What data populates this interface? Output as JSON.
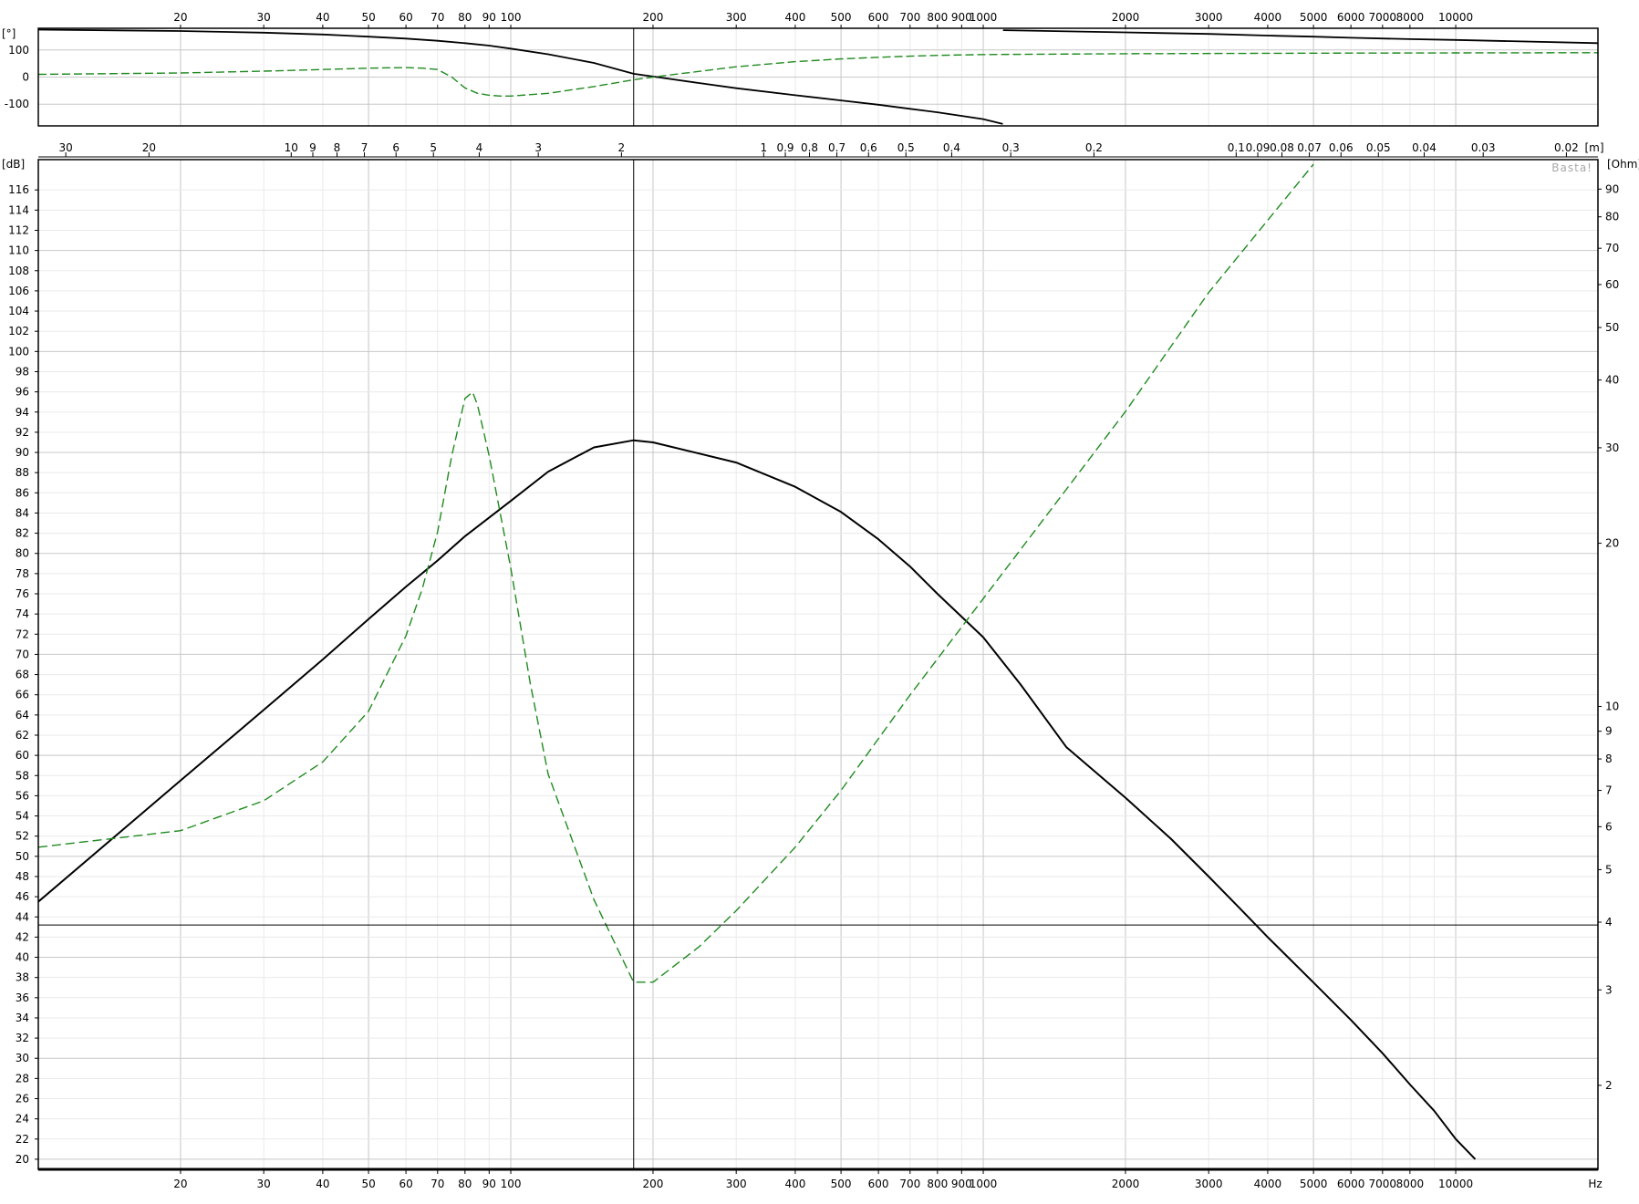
{
  "chart_data": [
    {
      "type": "line",
      "panel": "phase",
      "ylabel": "[°]",
      "y_ticks": [
        -100,
        0,
        100
      ],
      "x_ticks": [
        20,
        30,
        40,
        50,
        60,
        70,
        80,
        90,
        100,
        200,
        300,
        400,
        500,
        600,
        700,
        800,
        900,
        1000,
        2000,
        3000,
        4000,
        5000,
        6000,
        7000,
        8000,
        10000
      ],
      "xlim": [
        10,
        20000
      ],
      "ylim": [
        -180,
        180
      ],
      "x_scale": "log",
      "grid": true,
      "cursor_x": 182,
      "series": [
        {
          "color": "#000000",
          "style": "solid",
          "x": [
            10,
            20,
            30,
            40,
            50,
            60,
            70,
            80,
            90,
            100,
            120,
            150,
            182,
            200,
            250,
            300,
            400,
            500,
            600,
            700,
            800,
            1000,
            1100,
            1101,
            2000,
            3000,
            4000,
            5000,
            6000,
            8000,
            10000,
            20000
          ],
          "y": [
            175,
            170,
            164,
            157,
            149,
            142,
            134,
            125,
            116,
            105,
            84,
            52,
            12,
            2,
            -22,
            -41,
            -67,
            -86,
            -102,
            -117,
            -130,
            -155,
            -173,
            173,
            165,
            159,
            153,
            149,
            145,
            140,
            137,
            125
          ]
        },
        {
          "color": "#1f8a1f",
          "style": "dashed",
          "x": [
            10,
            20,
            30,
            40,
            50,
            60,
            65,
            70,
            75,
            80,
            85,
            90,
            95,
            100,
            120,
            150,
            182,
            200,
            300,
            400,
            500,
            600,
            700,
            800,
            1000,
            2000,
            5000,
            10000,
            20000
          ],
          "y": [
            10,
            15,
            22,
            28,
            33,
            35,
            33,
            28,
            0,
            -40,
            -60,
            -67,
            -70,
            -70,
            -60,
            -35,
            -10,
            0,
            38,
            57,
            67,
            73,
            77,
            80,
            83,
            86,
            88,
            89,
            90
          ]
        }
      ]
    },
    {
      "type": "line",
      "panel": "spl-impedance",
      "ylabel": "[dB]",
      "y2label": "[Ohm]",
      "xlabel": "Hz",
      "top_axis_label": "[m]",
      "annotation": "Basta!",
      "x_scale": "log",
      "xlim": [
        10,
        20000
      ],
      "ylim": [
        19,
        119
      ],
      "y2_scale": "log",
      "y2lim": [
        1.4,
        102
      ],
      "grid": true,
      "cursor_x": 182,
      "cursor_y": 43.2,
      "y_ticks": [
        20,
        22,
        24,
        26,
        28,
        30,
        32,
        34,
        36,
        38,
        40,
        42,
        44,
        46,
        48,
        50,
        52,
        54,
        56,
        58,
        60,
        62,
        64,
        66,
        68,
        70,
        72,
        74,
        76,
        78,
        80,
        82,
        84,
        86,
        88,
        90,
        92,
        94,
        96,
        98,
        100,
        102,
        104,
        106,
        108,
        110,
        112,
        114,
        116
      ],
      "y2_ticks": [
        2,
        3,
        4,
        5,
        6,
        7,
        8,
        9,
        10,
        20,
        30,
        40,
        50,
        60,
        70,
        80,
        90
      ],
      "x_ticks": [
        20,
        30,
        40,
        50,
        60,
        70,
        80,
        90,
        100,
        200,
        300,
        400,
        500,
        600,
        700,
        800,
        900,
        1000,
        2000,
        3000,
        4000,
        5000,
        6000,
        7000,
        8000,
        10000
      ],
      "x_tick_labels": [
        "20",
        "30",
        "40",
        "50",
        "60",
        "70",
        "80",
        "90",
        "100",
        "200",
        "300",
        "400",
        "500",
        "600",
        "700",
        "800",
        "900",
        "1000",
        "2000",
        "3000",
        "4000",
        "5000",
        "6000",
        "7000",
        "8000",
        "10000"
      ],
      "wavelength_ticks": [
        "30",
        "20",
        "10",
        "9",
        "8",
        "7",
        "6",
        "5",
        "4",
        "3",
        "2",
        "1",
        "0.9",
        "0.8",
        "0.7",
        "0.6",
        "0.5",
        "0.4",
        "0.3",
        "0.2",
        "0.1",
        "0.09",
        "0.08",
        "0.07",
        "0.06",
        "0.05",
        "0.04",
        "0.03",
        "0.02"
      ],
      "series": [
        {
          "axis": "left",
          "color": "#000000",
          "style": "solid",
          "x": [
            10,
            20,
            30,
            40,
            50,
            60,
            70,
            80,
            100,
            120,
            150,
            182,
            200,
            300,
            400,
            500,
            600,
            700,
            800,
            1000,
            1200,
            1500,
            2000,
            2500,
            3000,
            3500,
            4000,
            5000,
            6000,
            7000,
            8000,
            9000,
            10000,
            11000
          ],
          "y": [
            45.5,
            57.5,
            64.5,
            69.5,
            73.5,
            76.7,
            79.3,
            81.7,
            85.2,
            88.1,
            90.5,
            91.2,
            91.0,
            89.0,
            86.6,
            84.1,
            81.4,
            78.7,
            76.0,
            71.7,
            67.0,
            60.8,
            55.8,
            51.7,
            48.0,
            44.8,
            42.0,
            37.5,
            33.8,
            30.5,
            27.4,
            24.8,
            22.0,
            20.0
          ]
        },
        {
          "axis": "right",
          "color": "#1f8a1f",
          "style": "dashed",
          "x": [
            10,
            20,
            30,
            40,
            50,
            60,
            65,
            70,
            75,
            80,
            83,
            85,
            90,
            100,
            110,
            120,
            150,
            182,
            200,
            250,
            300,
            400,
            500,
            700,
            1000,
            2000,
            3000,
            5000
          ],
          "y": [
            5.5,
            5.9,
            6.7,
            7.9,
            9.8,
            13.5,
            16.5,
            21.0,
            29.0,
            37.0,
            38.0,
            36.0,
            29.0,
            18.0,
            11.0,
            7.5,
            4.4,
            3.1,
            3.1,
            3.6,
            4.2,
            5.5,
            7.0,
            10.5,
            15.8,
            35.0,
            58.0,
            100.0
          ]
        }
      ]
    }
  ]
}
